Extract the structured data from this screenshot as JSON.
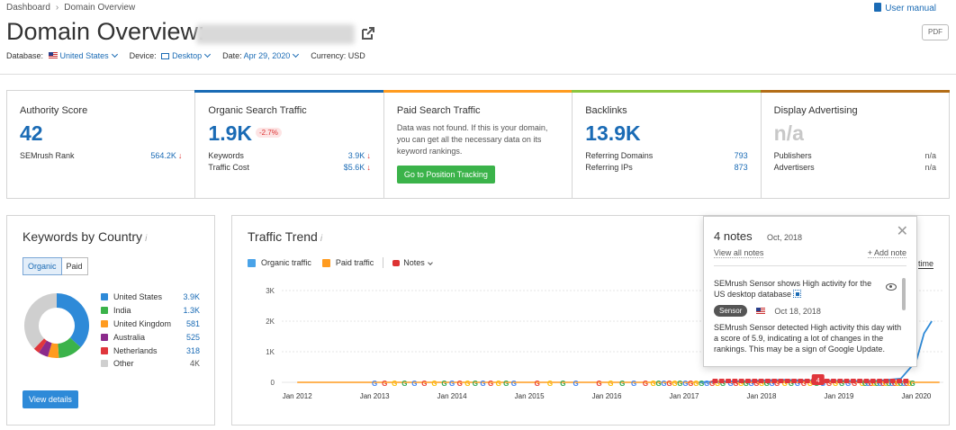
{
  "breadcrumb": {
    "home": "Dashboard",
    "current": "Domain Overview"
  },
  "manual_label": "User manual",
  "page_title": "Domain Overview:",
  "pdf_label": "PDF",
  "filters": {
    "database_label": "Database:",
    "database_value": "United States",
    "device_label": "Device:",
    "device_value": "Desktop",
    "date_label": "Date:",
    "date_value": "Apr 29, 2020",
    "currency_label": "Currency:",
    "currency_value": "USD"
  },
  "colors": {
    "accent": "#1a6bb5",
    "authority": "#1a6bb5",
    "organic": "#1a6bb5",
    "paid": "#ff9b1f",
    "backlinks": "#8cc63f",
    "display": "#b36d17"
  },
  "cards": {
    "authority": {
      "title": "Authority Score",
      "value": "42",
      "row1_label": "SEMrush Rank",
      "row1_value": "564.2K"
    },
    "organic": {
      "title": "Organic Search Traffic",
      "value": "1.9K",
      "change": "-2.7%",
      "row1_label": "Keywords",
      "row1_value": "3.9K",
      "row2_label": "Traffic Cost",
      "row2_value": "$5.6K"
    },
    "paid": {
      "title": "Paid Search Traffic",
      "text": "Data was not found. If this is your domain, you can get all the necessary data on its keyword rankings.",
      "button": "Go to Position Tracking"
    },
    "backlinks": {
      "title": "Backlinks",
      "value": "13.9K",
      "row1_label": "Referring Domains",
      "row1_value": "793",
      "row2_label": "Referring IPs",
      "row2_value": "873"
    },
    "display": {
      "title": "Display Advertising",
      "value": "n/a",
      "row1_label": "Publishers",
      "row1_value": "n/a",
      "row2_label": "Advertisers",
      "row2_value": "n/a"
    }
  },
  "kbc": {
    "title": "Keywords by Country",
    "info": "i",
    "tab_organic": "Organic",
    "tab_paid": "Paid",
    "countries": [
      {
        "name": "United States",
        "value": "3.9K",
        "color": "#2e8ad8"
      },
      {
        "name": "India",
        "value": "1.3K",
        "color": "#3bb34a"
      },
      {
        "name": "United Kingdom",
        "value": "581",
        "color": "#ff9b1f"
      },
      {
        "name": "Australia",
        "value": "525",
        "color": "#8b2a8b"
      },
      {
        "name": "Netherlands",
        "value": "318",
        "color": "#e0363c"
      },
      {
        "name": "Other",
        "value": "4K",
        "color": "#cfcfcf"
      }
    ],
    "button": "View details"
  },
  "trend": {
    "title": "Traffic Trend",
    "info": "i",
    "legend_organic": "Organic traffic",
    "legend_paid": "Paid traffic",
    "legend_notes": "Notes",
    "period_partial": "time"
  },
  "chart_data": {
    "type": "line",
    "title": "Traffic Trend",
    "yticks": [
      "3K",
      "2K",
      "1K",
      "0"
    ],
    "ylim": [
      0,
      3000
    ],
    "xticks": [
      "Jan 2012",
      "Jan 2013",
      "Jan 2014",
      "Jan 2015",
      "Jan 2016",
      "Jan 2017",
      "Jan 2018",
      "Jan 2019",
      "Jan 2020"
    ],
    "series": [
      {
        "name": "Organic traffic",
        "color": "#2e8ad8",
        "x": [
          2017.2,
          2017.5,
          2017.8,
          2018.0,
          2018.3,
          2018.6,
          2018.9,
          2019.2,
          2019.5,
          2019.8,
          2020.0,
          2020.1,
          2020.2
        ],
        "values": [
          5,
          20,
          40,
          60,
          80,
          60,
          50,
          40,
          50,
          120,
          700,
          1600,
          2000
        ]
      },
      {
        "name": "Paid traffic",
        "color": "#ff9b1f",
        "x": [
          2012.0,
          2020.3
        ],
        "values": [
          0,
          0
        ]
      }
    ],
    "annotation_markers": [
      "G",
      "G",
      "G",
      "G",
      "G",
      "G",
      "G",
      "G",
      "G",
      "G",
      "G",
      "G",
      "G",
      "G",
      "G",
      "G",
      "G",
      "G",
      "G",
      "G",
      "G",
      "G",
      "G",
      "G",
      "G",
      "G",
      "G",
      "G",
      "G",
      "G",
      "G",
      "G",
      "G",
      "G",
      "G",
      "G",
      "G",
      "G",
      "G",
      "G",
      "G",
      "G",
      "G",
      "G",
      "G",
      "G",
      "G",
      "G",
      "G",
      "G",
      "G",
      "G",
      "G",
      "G",
      "G",
      "G",
      "G",
      "G",
      "G",
      "G",
      "G",
      "G",
      "G",
      "G",
      "G",
      "G",
      "G",
      "G",
      "G",
      "G",
      "G",
      "G",
      "G",
      "G",
      "G",
      "G",
      "G",
      "G",
      "G",
      "G"
    ],
    "notes_badge": "4"
  },
  "popup": {
    "count": "4 notes",
    "date": "Oct, 2018",
    "view_all": "View all notes",
    "add": "+ Add note",
    "note_title": "SEMrush Sensor shows High activity for the US desktop database",
    "tag": "Sensor",
    "note_date": "Oct 18, 2018",
    "description": "SEMrush Sensor detected High activity this day with a score of 5.9, indicating a lot of changes in the rankings. This may be a sign of Google Update."
  }
}
